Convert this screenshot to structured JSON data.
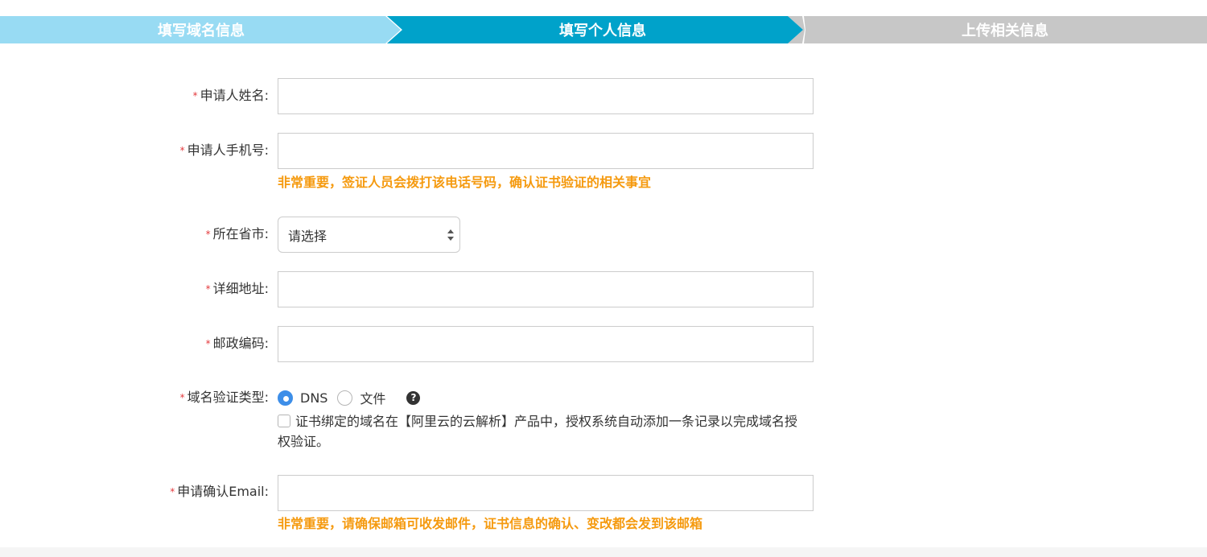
{
  "stepper": {
    "steps": [
      {
        "label": "填写域名信息",
        "state": "done"
      },
      {
        "label": "填写个人信息",
        "state": "active"
      },
      {
        "label": "上传相关信息",
        "state": "todo"
      }
    ]
  },
  "form": {
    "required_mark": "*",
    "name_label": "申请人姓名:",
    "name_value": "",
    "phone_label": "申请人手机号:",
    "phone_value": "",
    "phone_hint": "非常重要，签证人员会拨打该电话号码，确认证书验证的相关事宜",
    "province_label": "所在省市:",
    "province_selected": "请选择",
    "address_label": "详细地址:",
    "address_value": "",
    "zip_label": "邮政编码:",
    "zip_value": "",
    "verify_label": "域名验证类型:",
    "verify_options": [
      {
        "label": "DNS",
        "checked": true
      },
      {
        "label": "文件",
        "checked": false
      }
    ],
    "help_glyph": "?",
    "auth_checkbox_text": "证书绑定的域名在【阿里云的云解析】产品中，授权系统自动添加一条记录以完成域名授权验证。",
    "email_label": "申请确认Email:",
    "email_value": "",
    "email_hint": "非常重要，请确保邮箱可收发邮件，证书信息的确认、变改都会发到该邮箱"
  },
  "colors": {
    "step_done": "#98dbf3",
    "step_active": "#00a2ca",
    "step_todo": "#c7c7c7",
    "required": "#e4393c",
    "hint": "#f59a0f",
    "radio_checked": "#3d8ee8"
  }
}
